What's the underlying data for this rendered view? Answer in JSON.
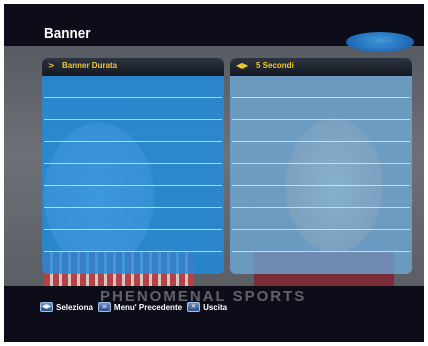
{
  "header": {
    "title": "Banner"
  },
  "menu": {
    "selected_item": {
      "arrow": ">",
      "label": "Banner Durata"
    },
    "selected_value": {
      "arrows": "◀▶",
      "value": "5 Secondi"
    }
  },
  "background": {
    "watermark": "PHENOMENAL SPORTS"
  },
  "footer": {
    "items": [
      {
        "icon": "nav-arrows-key-icon",
        "label": "Seleziona"
      },
      {
        "icon": "menu-key-icon",
        "label": "Menu' Precedente"
      },
      {
        "icon": "exit-key-icon",
        "label": "Uscita"
      }
    ]
  },
  "colors": {
    "panel_left": "#1e8ce1",
    "panel_right": "#6eafe1",
    "header_text": "#f0c830",
    "background": "#0d0d1a"
  }
}
